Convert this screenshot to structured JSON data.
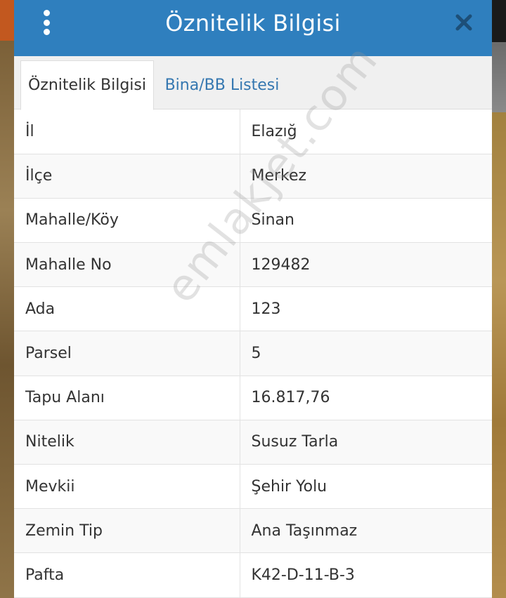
{
  "dialog": {
    "title": "Öznitelik Bilgisi",
    "menu_icon": "more-vertical-icon",
    "close_icon": "close-icon"
  },
  "tabs": [
    {
      "label": "Öznitelik Bilgisi",
      "active": true
    },
    {
      "label": "Bina/BB Listesi",
      "active": false
    }
  ],
  "attributes": [
    {
      "key": "İl",
      "value": "Elazığ"
    },
    {
      "key": "İlçe",
      "value": "Merkez"
    },
    {
      "key": "Mahalle/Köy",
      "value": "Sinan"
    },
    {
      "key": "Mahalle No",
      "value": "129482"
    },
    {
      "key": "Ada",
      "value": "123"
    },
    {
      "key": "Parsel",
      "value": "5"
    },
    {
      "key": "Tapu Alanı",
      "value": "16.817,76"
    },
    {
      "key": "Nitelik",
      "value": "Susuz Tarla"
    },
    {
      "key": "Mevkii",
      "value": "Şehir Yolu"
    },
    {
      "key": "Zemin Tip",
      "value": "Ana Taşınmaz"
    },
    {
      "key": "Pafta",
      "value": "K42-D-11-B-3"
    }
  ],
  "watermark": "emlakjet.com",
  "colors": {
    "header": "#2f7fbe",
    "tab_link": "#3577b0",
    "text": "#333333"
  }
}
